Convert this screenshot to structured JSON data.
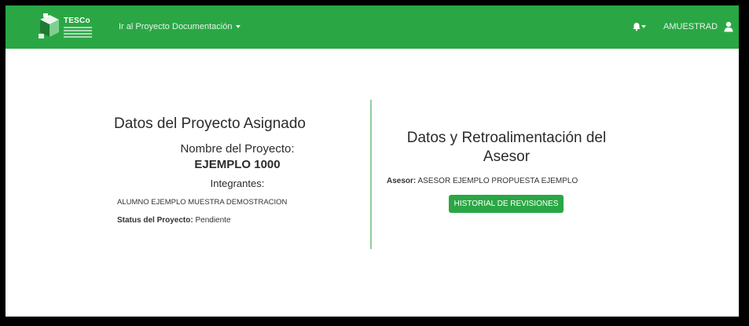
{
  "navbar": {
    "logo_text": "TESCo",
    "link_project": "Ir al Proyecto",
    "link_docs": "Documentación",
    "user_name": "AMUESTRAD",
    "icons": [
      "logo-mark",
      "bell-icon",
      "caret-down-icon",
      "user-icon"
    ],
    "bg_color": "#2aa744"
  },
  "left": {
    "title": "Datos del Proyecto Asignado",
    "project_label": "Nombre del Proyecto:",
    "project_name": "EJEMPLO 1000",
    "members_label": "Integrantes:",
    "members": "ALUMNO EJEMPLO MUESTRA DEMOSTRACION",
    "status_label": "Status del Proyecto:",
    "status_value": "Pendiente"
  },
  "right": {
    "title": "Datos y Retroalimentación del Asesor",
    "asesor_label": "Asesor:",
    "asesor_value": "ASESOR EJEMPLO PROPUESTA EJEMPLO",
    "history_button": "HISTORIAL DE REVISIONES"
  }
}
